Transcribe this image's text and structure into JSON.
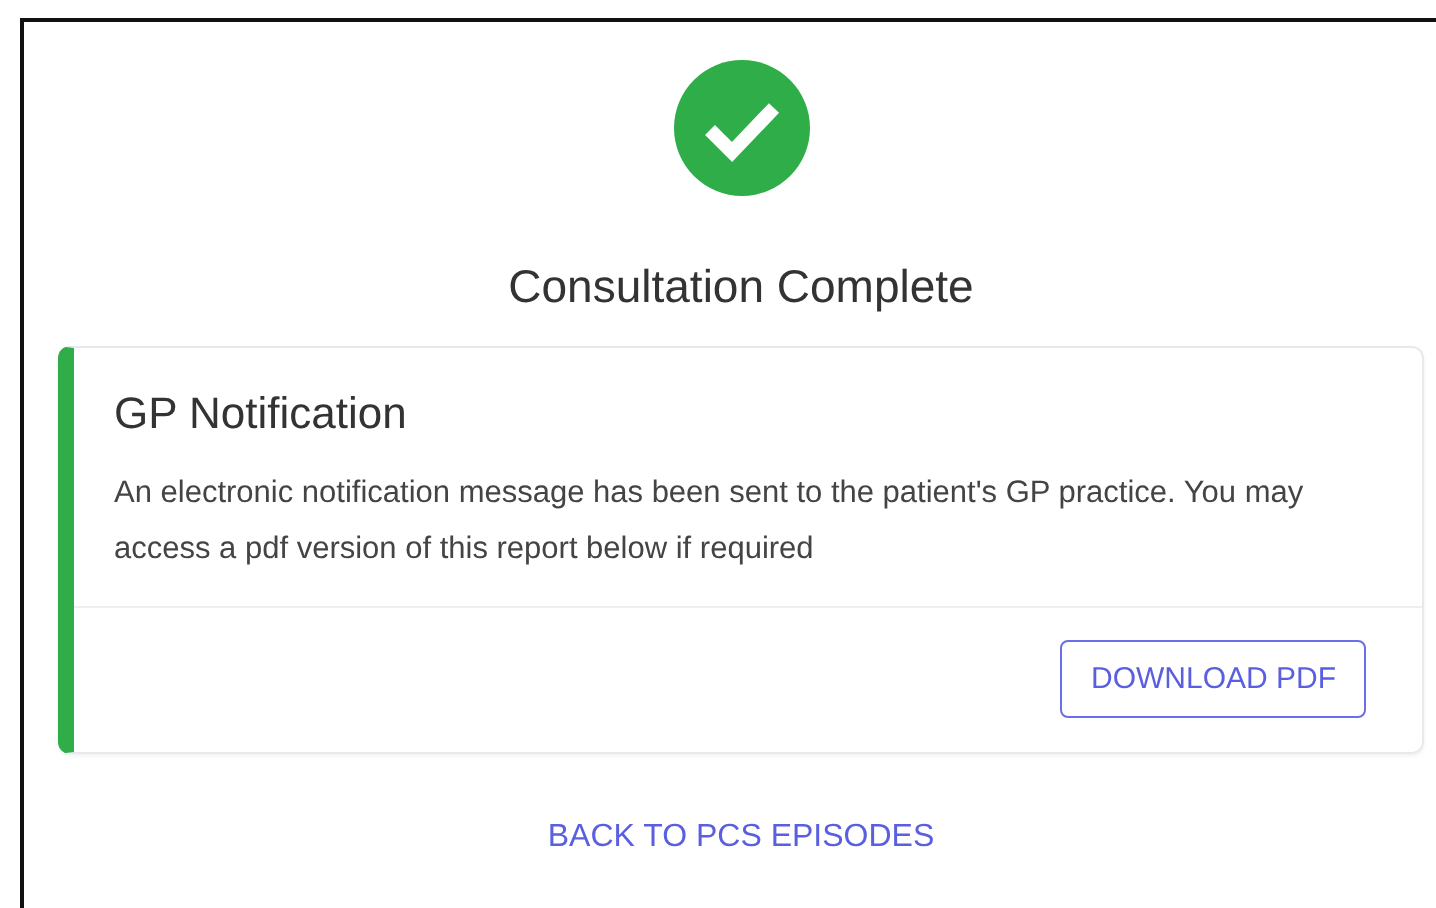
{
  "status": {
    "kind": "success",
    "title": "Consultation Complete"
  },
  "card": {
    "title": "GP Notification",
    "message": "An electronic notification message has been sent to the patient's GP practice. You may access a pdf version of this report below if required",
    "button": "DOWNLOAD PDF"
  },
  "link": "BACK TO PCS EPISODES"
}
